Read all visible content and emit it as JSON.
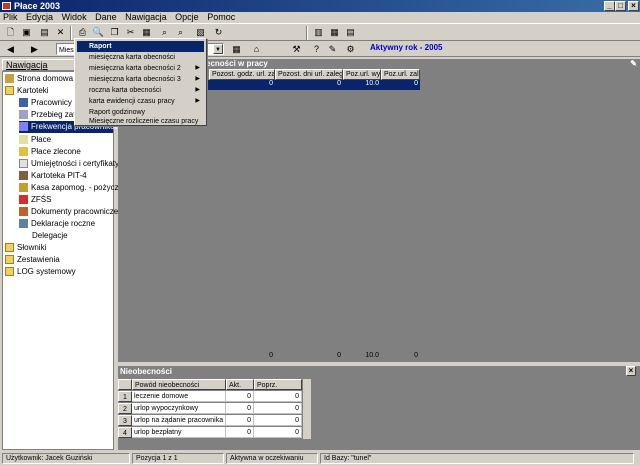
{
  "window": {
    "title": "Płace 2003",
    "min": "_",
    "max": "□",
    "close": "×"
  },
  "menubar": [
    "Plik",
    "Edycja",
    "Widok",
    "Dane",
    "Nawigacja",
    "Opcje",
    "Pomoc"
  ],
  "toolbar2": {
    "combo_value": "Miesią",
    "active_year": "Aktywny rok - 2005"
  },
  "context_menu": {
    "items": [
      {
        "label": "Raport",
        "submenu": false,
        "highlighted": true
      },
      {
        "label": "miesięczna karta obecności",
        "submenu": false
      },
      {
        "label": "miesięczna karta obecności 2",
        "submenu": true
      },
      {
        "label": "miesięczna karta obecności 3",
        "submenu": true
      },
      {
        "label": "roczna karta obecności",
        "submenu": true
      },
      {
        "label": "karta ewidencji czasu pracy",
        "submenu": true
      },
      {
        "label": "Raport godzinowy",
        "submenu": false
      },
      {
        "label": "Miesięczne rozliczenie czasu pracy",
        "submenu": false
      }
    ]
  },
  "navigation": {
    "header": "Nawigacja",
    "items": [
      {
        "label": "Strona domowa ap",
        "icon": "home-icon",
        "level": 0
      },
      {
        "label": "Kartoteki",
        "icon": "folder-open-icon",
        "level": 0
      },
      {
        "label": "Pracownicy",
        "icon": "people-icon",
        "level": 1
      },
      {
        "label": "Przebieg zatru",
        "icon": "document-icon",
        "level": 1
      },
      {
        "label": "Frekwencja pracowników",
        "icon": "attendance-icon",
        "level": 1,
        "selected": true
      },
      {
        "label": "Płace",
        "icon": "document-icon",
        "level": 1
      },
      {
        "label": "Płace zlecone",
        "icon": "document-icon",
        "level": 1
      },
      {
        "label": "Umiejętności i certyfikaty",
        "icon": "document-icon",
        "level": 1
      },
      {
        "label": "Kartoteka PIT-4",
        "icon": "person-icon",
        "level": 1
      },
      {
        "label": "Kasa zapomog. - pożyczk.",
        "icon": "money-icon",
        "level": 1
      },
      {
        "label": "ZFŚS",
        "icon": "cross-icon",
        "level": 1
      },
      {
        "label": "Dokumenty pracownicze",
        "icon": "document-icon",
        "level": 1
      },
      {
        "label": "Deklaracje roczne",
        "icon": "document-icon",
        "level": 1
      },
      {
        "label": "Delegacje",
        "icon": "none",
        "level": 1
      },
      {
        "label": "Słowniki",
        "icon": "folder-icon",
        "level": 0
      },
      {
        "label": "Zestawienia",
        "icon": "folder-icon",
        "level": 0
      },
      {
        "label": "LOG systemowy",
        "icon": "folder-icon",
        "level": 0
      }
    ]
  },
  "main_grid": {
    "title": "ecności w pracy",
    "columns": [
      "Pozost. godz. url. zaleg",
      "Pozost. dni url. zaległ",
      "Poz.url. wyp",
      "Poz.url. zal.u"
    ],
    "selected_row": [
      "0",
      "0",
      "10.0",
      "0"
    ],
    "totals": [
      "0",
      "0",
      "10.0",
      "0"
    ]
  },
  "absences": {
    "title": "Nieobecności",
    "close": "×",
    "columns": [
      "Powód nieobecności",
      "Akt.",
      "Poprz."
    ],
    "rows": [
      {
        "n": "1",
        "reason": "leczenie domowe",
        "akt": "0",
        "poprz": "0"
      },
      {
        "n": "2",
        "reason": "urlop wypoczynkowy",
        "akt": "0",
        "poprz": "0"
      },
      {
        "n": "3",
        "reason": "urlop na żądanie pracownika",
        "akt": "0",
        "poprz": "0"
      },
      {
        "n": "4",
        "reason": "urlop bezpłatny",
        "akt": "0",
        "poprz": "0"
      }
    ]
  },
  "status": {
    "user": "Użytkownik: Jacek Guziński",
    "position": "Pozycja 1 z 1",
    "state": "Aktywna w oczekiwaniu",
    "db": "Id Bazy: \"tunel\""
  }
}
